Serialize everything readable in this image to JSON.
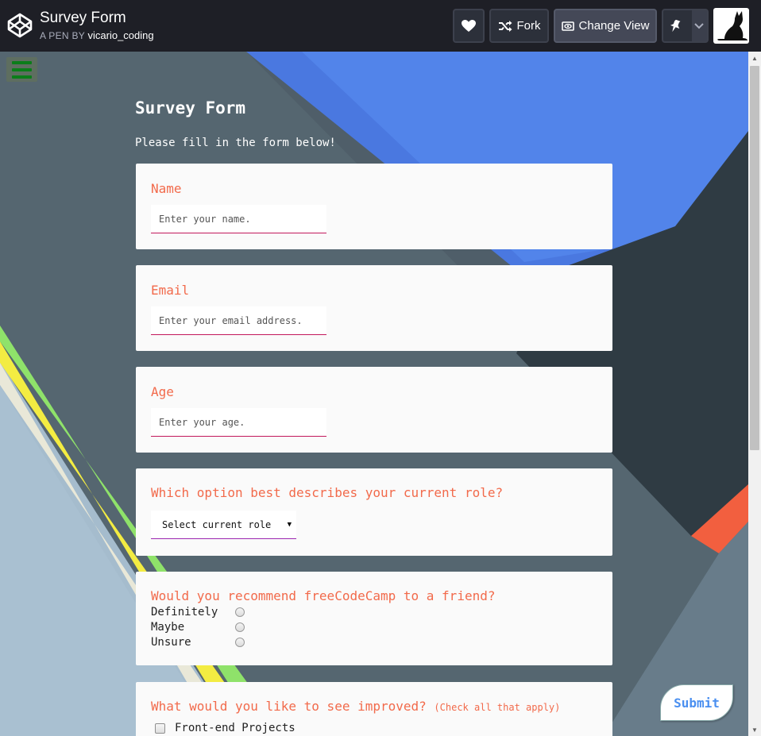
{
  "header": {
    "title": "Survey Form",
    "pen_by_prefix": "A PEN BY",
    "author": "vicario_coding",
    "fork_label": "Fork",
    "change_view_label": "Change View"
  },
  "form": {
    "title": "Survey Form",
    "description": "Please fill in the form below!",
    "name": {
      "label": "Name",
      "placeholder": "Enter your name."
    },
    "email": {
      "label": "Email",
      "placeholder": "Enter your email address."
    },
    "age": {
      "label": "Age",
      "placeholder": "Enter your age."
    },
    "role": {
      "label": "Which option best describes your current role?",
      "selected": "Select current role"
    },
    "recommend": {
      "label": "Would you recommend freeCodeCamp to a friend?",
      "options": [
        "Definitely",
        "Maybe",
        "Unsure"
      ]
    },
    "improve": {
      "label": "What would you like to see improved?",
      "hint": "(Check all that apply)",
      "options": [
        "Front-end Projects"
      ]
    },
    "submit_label": "Submit"
  },
  "colors": {
    "label_color": "#f26a4b",
    "submit_text": "#4a8ff0",
    "menu_bars": "#0b7d1a"
  }
}
